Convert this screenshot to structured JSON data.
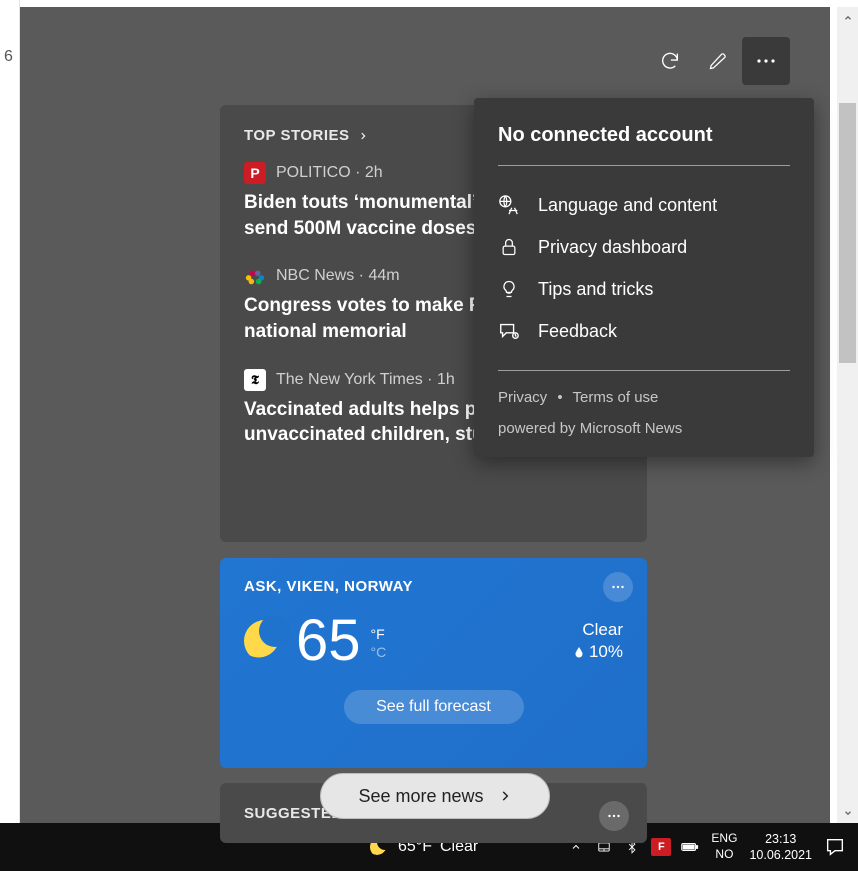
{
  "edge": {
    "num": "6"
  },
  "toolbar": {
    "refresh": "refresh",
    "edit": "edit",
    "more": "more"
  },
  "top_stories": {
    "header": "TOP STORIES",
    "items": [
      {
        "source": "POLITICO",
        "time": "2h",
        "headline": "Biden touts ‘monumental’ G-7 plan to send 500M vaccine doses"
      },
      {
        "source": "NBC News",
        "time": "44m",
        "headline": "Congress votes to make Pulse site a national memorial"
      },
      {
        "source": "The New York Times",
        "time": "1h",
        "headline": "Vaccinated adults helps protect unvaccinated children, study finds"
      }
    ]
  },
  "weather": {
    "location": "ASK, VIKEN, NORWAY",
    "temp": "65",
    "unit_f": "°F",
    "unit_c": "°C",
    "condition": "Clear",
    "precip": "10%",
    "forecast_btn": "See full forecast"
  },
  "see_more": "See more news",
  "suggested": {
    "header": "SUGGESTED FOR YOU"
  },
  "menu": {
    "title": "No connected account",
    "items": [
      {
        "icon": "language",
        "label": "Language and content"
      },
      {
        "icon": "lock",
        "label": "Privacy dashboard"
      },
      {
        "icon": "bulb",
        "label": "Tips and tricks"
      },
      {
        "icon": "feedback",
        "label": "Feedback"
      }
    ],
    "privacy": "Privacy",
    "dot": "•",
    "terms": "Terms of use",
    "powered": "powered by Microsoft News"
  },
  "taskbar": {
    "weather_temp": "65°F",
    "weather_cond": "Clear",
    "lang1": "ENG",
    "lang2": "NO",
    "time": "23:13",
    "date": "10.06.2021"
  }
}
